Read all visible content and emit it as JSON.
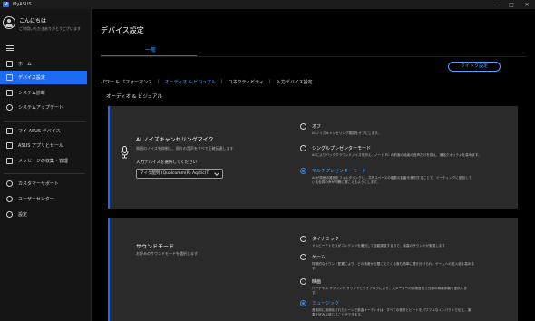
{
  "window": {
    "app_logo": "M",
    "app_title": "MyASUS",
    "controls": {
      "minimize": "—",
      "maximize": "□",
      "close": "✕"
    }
  },
  "profile": {
    "name": "こんにちは",
    "subtitle": "ご利用いただきありがとうございます"
  },
  "sidebar": {
    "items": [
      {
        "label": "ホーム",
        "icon": "home-icon"
      },
      {
        "label": "デバイス設定",
        "icon": "device-settings-icon",
        "active": true
      },
      {
        "label": "システム診断",
        "icon": "diagnosis-icon"
      },
      {
        "label": "システムアップデート",
        "icon": "update-icon"
      },
      {
        "label": "マイ ASUS デバイス",
        "icon": "my-device-icon"
      },
      {
        "label": "ASUS アプリとセール",
        "icon": "apps-icon"
      },
      {
        "label": "メッセージの収集・管理",
        "icon": "message-icon"
      },
      {
        "label": "カスタマーサポート",
        "icon": "support-icon"
      },
      {
        "label": "ユーザーセンター",
        "icon": "user-icon"
      },
      {
        "label": "設定",
        "icon": "gear-icon"
      }
    ]
  },
  "main": {
    "title": "デバイス設定",
    "tab": "一般",
    "quick_settings": "クイック設定",
    "subnav": [
      "パワー & パフォーマンス",
      "オーディオ & ビジュアル",
      "コネクティビティ",
      "入力デバイス設定"
    ],
    "subnav_separator": "|",
    "section_title": "オーディオ & ビジュアル"
  },
  "noise_card": {
    "title": "AI ノイズキャンセリングマイク",
    "desc": "周囲のノイズを抑制し、個々の音声をすべて正確伝達します",
    "select_label": "入力デバイスを選択してください",
    "select_value": "マイク配列 (Qualcomm(R) Aqstic(T",
    "options": [
      {
        "label": "オフ",
        "desc": [
          "AI ノイズキャンセリング機能をオフにします。"
        ],
        "selected": false
      },
      {
        "label": "シングルプレゼンターモード",
        "desc": [
          "AI によりバックグラウンドノイズを抑え、ノート PC の前面の話者の音声だけを捉え、通話クオリティを高めます。"
        ],
        "selected": false
      },
      {
        "label": "マルチプレゼンターモード",
        "desc": [
          "AI が周囲の雑音をフィルタリングし、共有スペースの複数の話者を識別することで、ミーティングに参加して",
          "いる全員の声が明瞭に聞こえるようにします。"
        ],
        "selected": true
      }
    ]
  },
  "sound_card": {
    "title": "サウンドモード",
    "desc": "お好みのサウンドモードを選択します",
    "options": [
      {
        "label": "ダイナミック",
        "desc": [
          "ドルビーアトモスがコンテンツを識別して自動調整するので、最高のサウンドが実現します"
        ],
        "selected": false
      },
      {
        "label": "ゲーム",
        "desc": [
          "特徴的なサウンド配置により、どの角度から聞こえてくる音も簡単に聞き分けられ、ゲームへの没入感を高めま",
          "す。"
        ],
        "selected": false
      },
      {
        "label": "映画",
        "desc": [
          "パーチャル サラウンド サウンドとダイアログにより、スターターの劇場音質で究極の映画体験を提供しま",
          "す。"
        ],
        "selected": false
      },
      {
        "label": "ミュージック",
        "desc": [
          "音楽用に最適化されたトーンで楽曲オーディオは、すべての音符とビートをパワフルなインパクトで伝え、演",
          "奏を好みな感じることができます。"
        ],
        "selected": true
      },
      {
        "label": "音声",
        "desc": [],
        "selected": false
      }
    ]
  },
  "colors": {
    "accent": "#1d6bf3",
    "link": "#4da3ff",
    "card": "#2a2a2a",
    "sidebar": "#151515",
    "background": "#000000"
  }
}
